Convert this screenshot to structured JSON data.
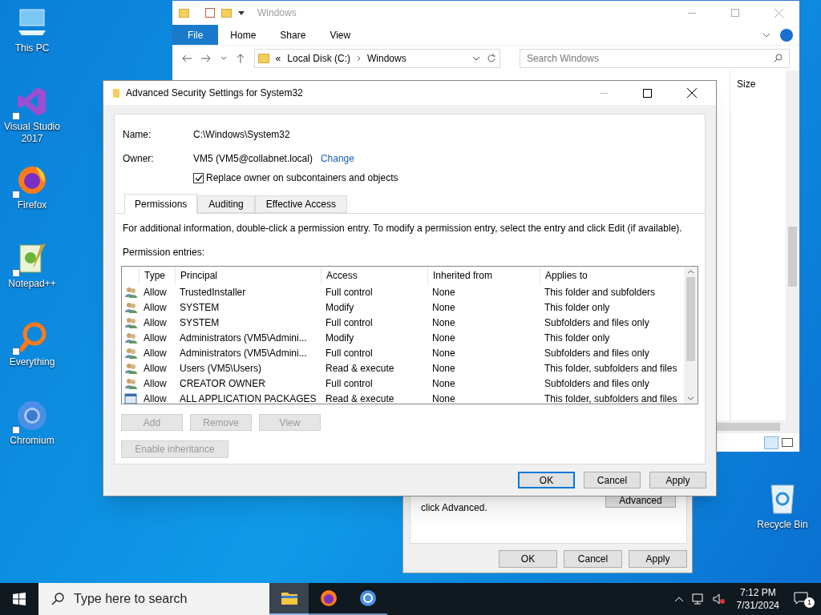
{
  "desktop_icons": [
    {
      "label": "This PC",
      "kind": "pc"
    },
    {
      "label": "Visual Studio 2017",
      "kind": "vs"
    },
    {
      "label": "Firefox",
      "kind": "firefox"
    },
    {
      "label": "Notepad++",
      "kind": "notepad"
    },
    {
      "label": "Everything",
      "kind": "everything"
    },
    {
      "label": "Chromium",
      "kind": "chromium"
    }
  ],
  "recycle_bin": {
    "label": "Recycle Bin"
  },
  "explorer": {
    "title": "Windows",
    "ribbon_tabs": [
      {
        "label": "File",
        "selected": true
      },
      {
        "label": "Home",
        "selected": false
      },
      {
        "label": "Share",
        "selected": false
      },
      {
        "label": "View",
        "selected": false
      }
    ],
    "address": [
      "Local Disk (C:)",
      "Windows"
    ],
    "address_prefix": "«",
    "search": {
      "placeholder": "Search Windows"
    },
    "column": "Size"
  },
  "properties_dialog": {
    "note": "click Advanced.",
    "advanced_button": "Advanced",
    "buttons": [
      "OK",
      "Cancel",
      "Apply"
    ]
  },
  "dialog": {
    "title": "Advanced Security Settings for System32",
    "name_label": "Name:",
    "name_value": "C:\\Windows\\System32",
    "owner_label": "Owner:",
    "owner_value": "VM5 (VM5@collabnet.local)",
    "change_link": "Change",
    "replace_owner": {
      "label": "Replace owner on subcontainers and objects",
      "checked": true
    },
    "tabs": [
      {
        "label": "Permissions",
        "selected": true
      },
      {
        "label": "Auditing",
        "selected": false
      },
      {
        "label": "Effective Access",
        "selected": false
      }
    ],
    "info": "For additional information, double-click a permission entry. To modify a permission entry, select the entry and click Edit (if available).",
    "entries_label": "Permission entries:",
    "table": {
      "columns": [
        "Type",
        "Principal",
        "Access",
        "Inherited from",
        "Applies to"
      ],
      "rows": [
        {
          "kind": "group",
          "cells": [
            "Allow",
            "TrustedInstaller",
            "Full control",
            "None",
            "This folder and subfolders"
          ]
        },
        {
          "kind": "group",
          "cells": [
            "Allow",
            "SYSTEM",
            "Modify",
            "None",
            "This folder only"
          ]
        },
        {
          "kind": "group",
          "cells": [
            "Allow",
            "SYSTEM",
            "Full control",
            "None",
            "Subfolders and files only"
          ]
        },
        {
          "kind": "group",
          "cells": [
            "Allow",
            "Administrators (VM5\\Admini...",
            "Modify",
            "None",
            "This folder only"
          ]
        },
        {
          "kind": "group",
          "cells": [
            "Allow",
            "Administrators (VM5\\Admini...",
            "Full control",
            "None",
            "Subfolders and files only"
          ]
        },
        {
          "kind": "group",
          "cells": [
            "Allow",
            "Users (VM5\\Users)",
            "Read & execute",
            "None",
            "This folder, subfolders and files"
          ]
        },
        {
          "kind": "group",
          "cells": [
            "Allow",
            "CREATOR OWNER",
            "Full control",
            "None",
            "Subfolders and files only"
          ]
        },
        {
          "kind": "package",
          "cells": [
            "Allow",
            "ALL APPLICATION PACKAGES",
            "Read & execute",
            "None",
            "This folder, subfolders and files"
          ]
        }
      ]
    },
    "entry_buttons": [
      {
        "label": "Add",
        "disabled": true
      },
      {
        "label": "Remove",
        "disabled": true
      },
      {
        "label": "View",
        "disabled": true
      }
    ],
    "inheritance_button": {
      "label": "Enable inheritance",
      "disabled": true
    },
    "buttons": [
      {
        "label": "OK",
        "default": true
      },
      {
        "label": "Cancel",
        "default": false
      },
      {
        "label": "Apply",
        "default": false
      }
    ]
  },
  "taskbar": {
    "search_placeholder": "Type here to search",
    "apps": [
      {
        "kind": "explorer",
        "selected": true
      },
      {
        "kind": "firefox",
        "selected": false
      },
      {
        "kind": "chromium",
        "selected": false
      }
    ],
    "time": "7:12 PM",
    "date": "7/31/2024",
    "notifications": "1"
  }
}
